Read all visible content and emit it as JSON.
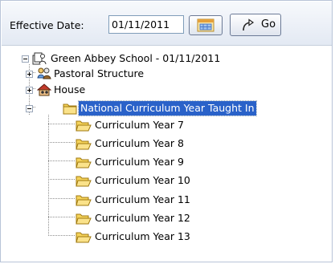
{
  "toolbar": {
    "effective_date_label": "Effective Date:",
    "effective_date_value": "01/11/2011",
    "go_label": "Go",
    "calendar_icon": "calendar-icon",
    "go_icon": "curved-arrow-icon"
  },
  "tree": {
    "root": {
      "label": "Green Abbey School - 01/11/2011",
      "icon": "school-icon",
      "expanded": true
    },
    "children": [
      {
        "label": "Pastoral Structure",
        "icon": "pastoral-structure-icon",
        "expanded": false
      },
      {
        "label": "House",
        "icon": "house-icon",
        "expanded": false
      },
      {
        "label": "National Curriculum Year Taught In",
        "icon": "folder-icon",
        "expanded": true,
        "selected": true,
        "children": [
          {
            "label": "Curriculum Year  7",
            "icon": "folder-open-icon"
          },
          {
            "label": "Curriculum Year  8",
            "icon": "folder-open-icon"
          },
          {
            "label": "Curriculum Year  9",
            "icon": "folder-open-icon"
          },
          {
            "label": "Curriculum Year 10",
            "icon": "folder-open-icon"
          },
          {
            "label": "Curriculum Year 11",
            "icon": "folder-open-icon"
          },
          {
            "label": "Curriculum Year 12",
            "icon": "folder-open-icon"
          },
          {
            "label": "Curriculum Year 13",
            "icon": "folder-open-icon"
          }
        ]
      }
    ]
  },
  "colors": {
    "selection": "#2a62c9",
    "folder": "#f4d25a"
  }
}
